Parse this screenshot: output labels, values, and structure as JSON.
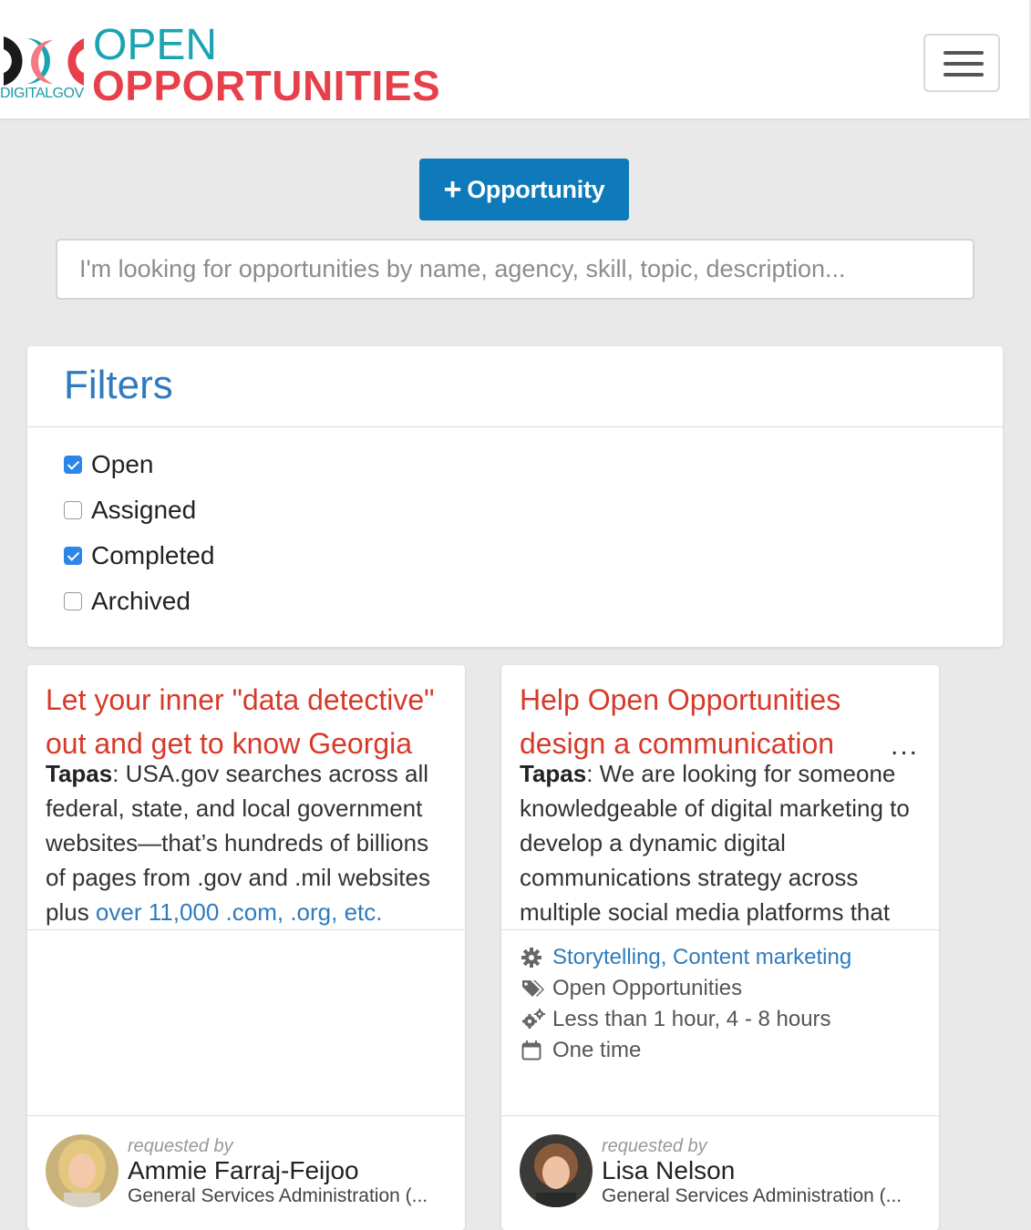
{
  "header": {
    "logo_open": "OPEN",
    "logo_opportunities": "OPPORTUNITIES",
    "logo_digitalgov": "DIGITALGOV",
    "menu_icon": "hamburger-icon"
  },
  "actions": {
    "add_plus": "+",
    "add_label": "Opportunity"
  },
  "search": {
    "placeholder": "I'm looking for opportunities by name, agency, skill, topic, description..."
  },
  "filters": {
    "title": "Filters",
    "items": [
      {
        "label": "Open",
        "checked": true
      },
      {
        "label": "Assigned",
        "checked": false
      },
      {
        "label": "Completed",
        "checked": true
      },
      {
        "label": "Archived",
        "checked": false
      }
    ]
  },
  "cards": [
    {
      "title": "Let your inner \"data detective\" out and get to know Georgia",
      "desc_prefix": "Tapas",
      "desc_text": ": USA.gov searches across all federal, state, and local government websites—that’s hundreds of billions of pages from .gov and .mil websites plus ",
      "desc_link": "over 11,000 .com, .org, etc.",
      "requested_by": "requested by",
      "name": "Ammie Farraj-Feijoo",
      "agency": "General Services Administration (..."
    },
    {
      "title": "Help Open Opportunities design a communication",
      "ellipsis": "...",
      "desc_prefix": "Tapas",
      "desc_text": ": We are looking for someone knowledgeable of digital marketing to develop a dynamic digital communications strategy across multiple social media platforms that",
      "skills": "Storytelling, Content marketing",
      "topic": "Open Opportunities",
      "time": "Less than 1 hour, 4 - 8 hours",
      "frequency": "One time",
      "requested_by": "requested by",
      "name": "Lisa Nelson",
      "agency": "General Services Administration (..."
    }
  ],
  "colors": {
    "brand_teal": "#1aa3b0",
    "brand_red": "#e8404a",
    "primary_blue": "#0f7ab9",
    "title_red": "#d63a2a",
    "link_blue": "#2f7bbd"
  }
}
